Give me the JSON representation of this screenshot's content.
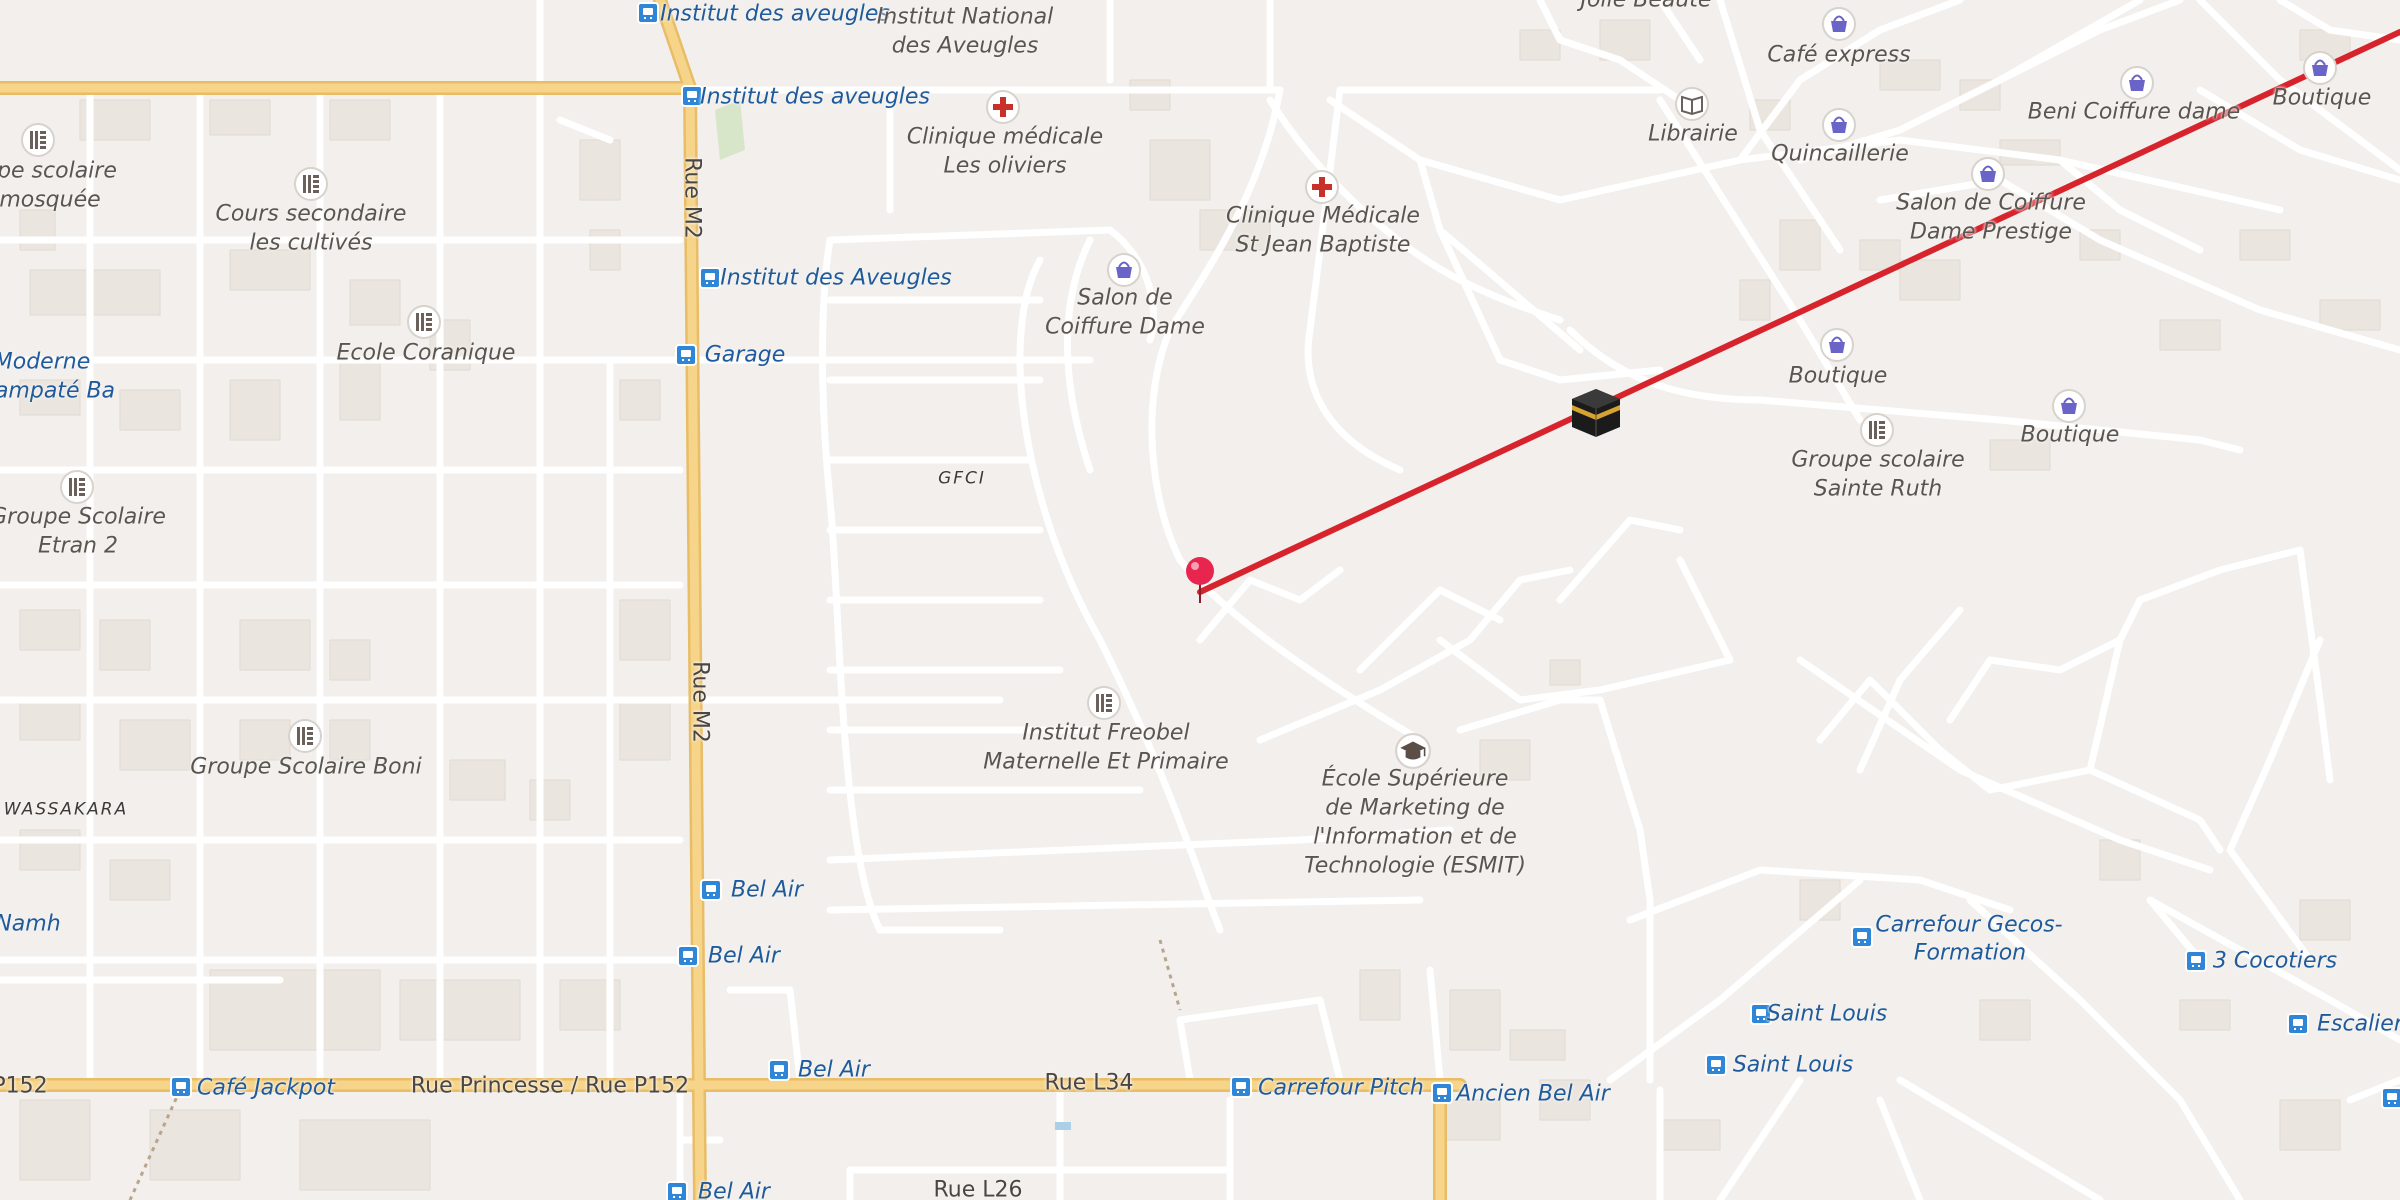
{
  "colors": {
    "background": "#f2efec",
    "major_road": "#f6d48a",
    "major_road_casing": "#e9bd66",
    "minor_road": "#ffffff",
    "building": "#ebe5df",
    "route_line": "#d7232c",
    "bus_stop": "#2f86d6",
    "hospital_cross": "#c8302a",
    "shop_icon": "#6a63c8",
    "pin": "#e8254f"
  },
  "roads": {
    "rue_m2_upper": "Rue M2",
    "rue_m2_lower": "Rue M2",
    "rue_princesse": "Rue Princesse / Rue P152",
    "p152": "P152",
    "rue_l34": "Rue L34",
    "rue_l26": "Rue L26"
  },
  "areas": {
    "gfci": "GFCI",
    "wassakara": "WASSAKARA"
  },
  "bus_stops": {
    "institut_aveugles_1": "Institut des aveugles",
    "institut_aveugles_2": "Institut des aveugles",
    "institut_aveugles_3": "Institut des Aveugles",
    "garage": "Garage",
    "bel_air_1": "Bel Air",
    "bel_air_2": "Bel Air",
    "bel_air_3": "Bel Air",
    "bel_air_4": "Bel Air",
    "cafe_jackpot": "Café Jackpot",
    "carrefour_pitch": "Carrefour Pitch",
    "ancien_bel_air": "Ancien Bel Air",
    "saint_louis_1": "Saint Louis",
    "saint_louis_2": "Saint Louis",
    "carrefour_gecos_1": "Carrefour Gecos-",
    "carrefour_gecos_2": "Formation",
    "trois_cocotiers": "3 Cocotiers",
    "escalier": "Escalier"
  },
  "pois": {
    "institut_national_1": "Institut National",
    "institut_national_2": "des Aveugles",
    "clinique_oliviers_1": "Clinique médicale",
    "clinique_oliviers_2": "Les oliviers",
    "clinique_st_jean_1": "Clinique Médicale",
    "clinique_st_jean_2": "St Jean Baptiste",
    "salon_coiffure_1": "Salon de",
    "salon_coiffure_2": "Coiffure Dame",
    "librairie": "Librairie",
    "cafe_express": "Café express",
    "quincaillerie": "Quincaillerie",
    "beni_coiffure": "Beni Coiffure dame",
    "boutique_top": "Boutique",
    "salon_prestige_1": "Salon de Coiffure",
    "salon_prestige_2": "Dame Prestige",
    "boutique_1": "Boutique",
    "boutique_2": "Boutique",
    "sainte_ruth_1": "Groupe scolaire",
    "sainte_ruth_2": "Sainte Ruth",
    "jolie_beaute": "Jolie Beauté",
    "groupe_mosquee_1": "upe scolaire",
    "groupe_mosquee_2": "mosquée",
    "cours_cultives_1": "Cours secondaire",
    "cours_cultives_2": "les cultivés",
    "ecole_coranique": "Ecole Coranique",
    "moderne_1": "Moderne",
    "moderne_2": "ampaté Ba",
    "etran_1": "Groupe Scolaire",
    "etran_2": "Etran 2",
    "boni": "Groupe Scolaire Boni",
    "namh": "Namh",
    "freobel_1": "Institut Freobel",
    "freobel_2": "Maternelle Et Primaire",
    "esmit_1": "École Supérieure",
    "esmit_2": "de Marketing de",
    "esmit_3": "l'Information et de",
    "esmit_4": "Technologie (ESMIT)"
  },
  "icons": {
    "bus": "bus-stop-icon",
    "school": "school-icon",
    "hospital": "hospital-icon",
    "shop": "shop-basket-icon",
    "book": "book-icon",
    "graduation": "graduation-cap-icon",
    "kaaba": "kaaba-qibla-icon",
    "pin": "location-pin-icon"
  }
}
